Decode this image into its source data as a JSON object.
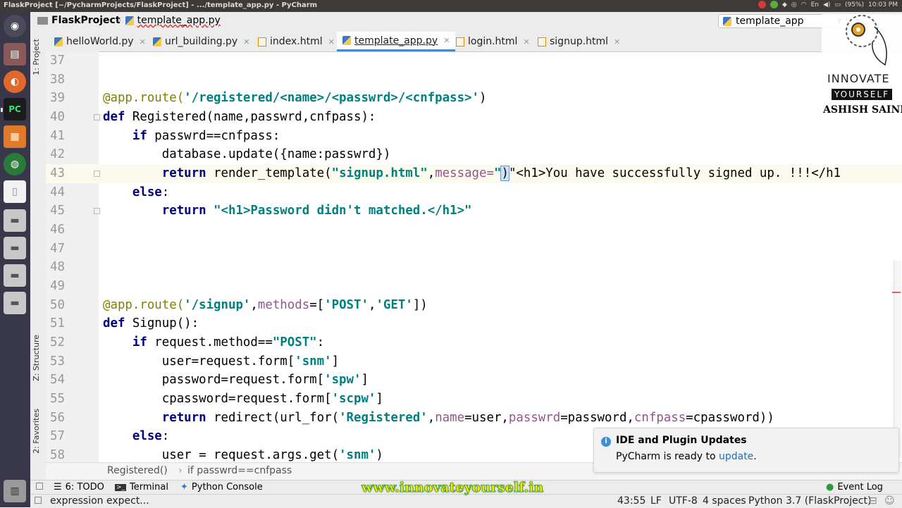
{
  "topbar": {
    "title": "FlaskProject [~/PycharmProjects/FlaskProject] - .../template_app.py - PyCharm",
    "battery": "(95%)",
    "lang": "En",
    "time": "10:03 PM"
  },
  "navbar": {
    "project": "FlaskProject",
    "file": "template_app.py",
    "run_config": "template_app"
  },
  "tabs": [
    {
      "label": "helloWorld.py"
    },
    {
      "label": "url_building.py"
    },
    {
      "label": "index.html"
    },
    {
      "label": "template_app.py"
    },
    {
      "label": "login.html"
    },
    {
      "label": "signup.html"
    }
  ],
  "side_tools": {
    "project": "1: Project",
    "structure": "Z: Structure",
    "favorites": "2: Favorites"
  },
  "code": {
    "lines": [
      {
        "num": "37"
      },
      {
        "num": "38"
      },
      {
        "num": "39",
        "a": "@app.route(",
        "b": "'/registered/<name>/<passwrd>/<cnfpass>'",
        "c": ")"
      },
      {
        "num": "40",
        "a": "def ",
        "b": "Registered(name,passwrd,cnfpass):"
      },
      {
        "num": "41",
        "a": "    if ",
        "b": "passwrd==cnfpass:"
      },
      {
        "num": "42",
        "a": "        database.update({name:passwrd})"
      },
      {
        "num": "43",
        "a": "        return ",
        "b": "render_template(",
        "c": "\"signup.html\"",
        "d": ",",
        "e": "message=",
        "f": "\"",
        "g": ")",
        "h": "\"<h1>You have successfully signed up. !!!</h1"
      },
      {
        "num": "44",
        "a": "    else",
        "b": ":"
      },
      {
        "num": "45",
        "a": "        return ",
        "b": "\"<h1>Password didn't matched.</h1>\""
      },
      {
        "num": "46"
      },
      {
        "num": "47"
      },
      {
        "num": "48"
      },
      {
        "num": "49"
      },
      {
        "num": "50",
        "a": "@app.route(",
        "b": "'/signup'",
        "c": ",",
        "d": "methods",
        "e": "=[",
        "f": "'POST'",
        "g": ",",
        "h": "'GET'",
        "i": "])"
      },
      {
        "num": "51",
        "a": "def ",
        "b": "Signup():"
      },
      {
        "num": "52",
        "a": "    if ",
        "b": "request.method==",
        "c": "\"POST\"",
        "d": ":"
      },
      {
        "num": "53",
        "a": "        user=request.form[",
        "b": "'snm'",
        "c": "]"
      },
      {
        "num": "54",
        "a": "        password=request.form[",
        "b": "'spw'",
        "c": "]"
      },
      {
        "num": "55",
        "a": "        cpassword=request.form[",
        "b": "'scpw'",
        "c": "]"
      },
      {
        "num": "56",
        "a": "        return ",
        "b": "redirect(url_for(",
        "c": "'Registered'",
        "d": ",",
        "e": "name",
        "f": "=user,",
        "g": "passwrd",
        "h": "=password,",
        "i": "cnfpass",
        "j": "=cpassword))"
      },
      {
        "num": "57",
        "a": "    else",
        "b": ":"
      },
      {
        "num": "58",
        "a": "        user = request.args.get(",
        "b": "'snm'",
        "c": ")"
      }
    ]
  },
  "context_breadcrumb": {
    "fn": "Registered()",
    "cond": "if passwrd==cnfpass"
  },
  "toolwindows": {
    "todo": "6: TODO",
    "terminal": "Terminal",
    "python_console": "Python Console",
    "event_log": "Event Log"
  },
  "statusbar": {
    "message": "expression expect...",
    "position": "43:55",
    "line_sep": "LF",
    "encoding": "UTF-8",
    "indent": "4 spaces",
    "interpreter": "Python 3.7 (FlaskProject)"
  },
  "notification": {
    "title": "IDE and Plugin Updates",
    "body_prefix": "PyCharm is ready to ",
    "link": "update",
    "body_suffix": "."
  },
  "watermark": {
    "url": "www.innovateyourself.in",
    "brand1": "INNOVATE",
    "brand2": "YOURSELF",
    "author": "ASHISH SAINI"
  },
  "colors": {
    "keyword": "#000080",
    "string": "#008080",
    "decorator": "#808000",
    "param": "#94558d",
    "accent": "#4a88c7"
  }
}
